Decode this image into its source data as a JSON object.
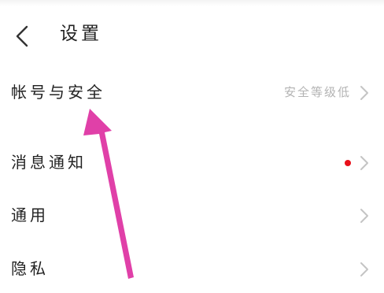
{
  "header": {
    "title": "设置",
    "back_icon": "chevron-left-icon"
  },
  "settings": {
    "account": {
      "label": "帐号与安全",
      "value": "安全等级低"
    },
    "notifications": {
      "label": "消息通知",
      "has_unread_dot": true
    },
    "general": {
      "label": "通用"
    },
    "privacy": {
      "label": "隐私"
    }
  },
  "colors": {
    "annotation_arrow": "#e040a8",
    "unread_dot": "#e8101a",
    "secondary_text": "#b3b3b3",
    "chevron": "#c4c4c4"
  }
}
